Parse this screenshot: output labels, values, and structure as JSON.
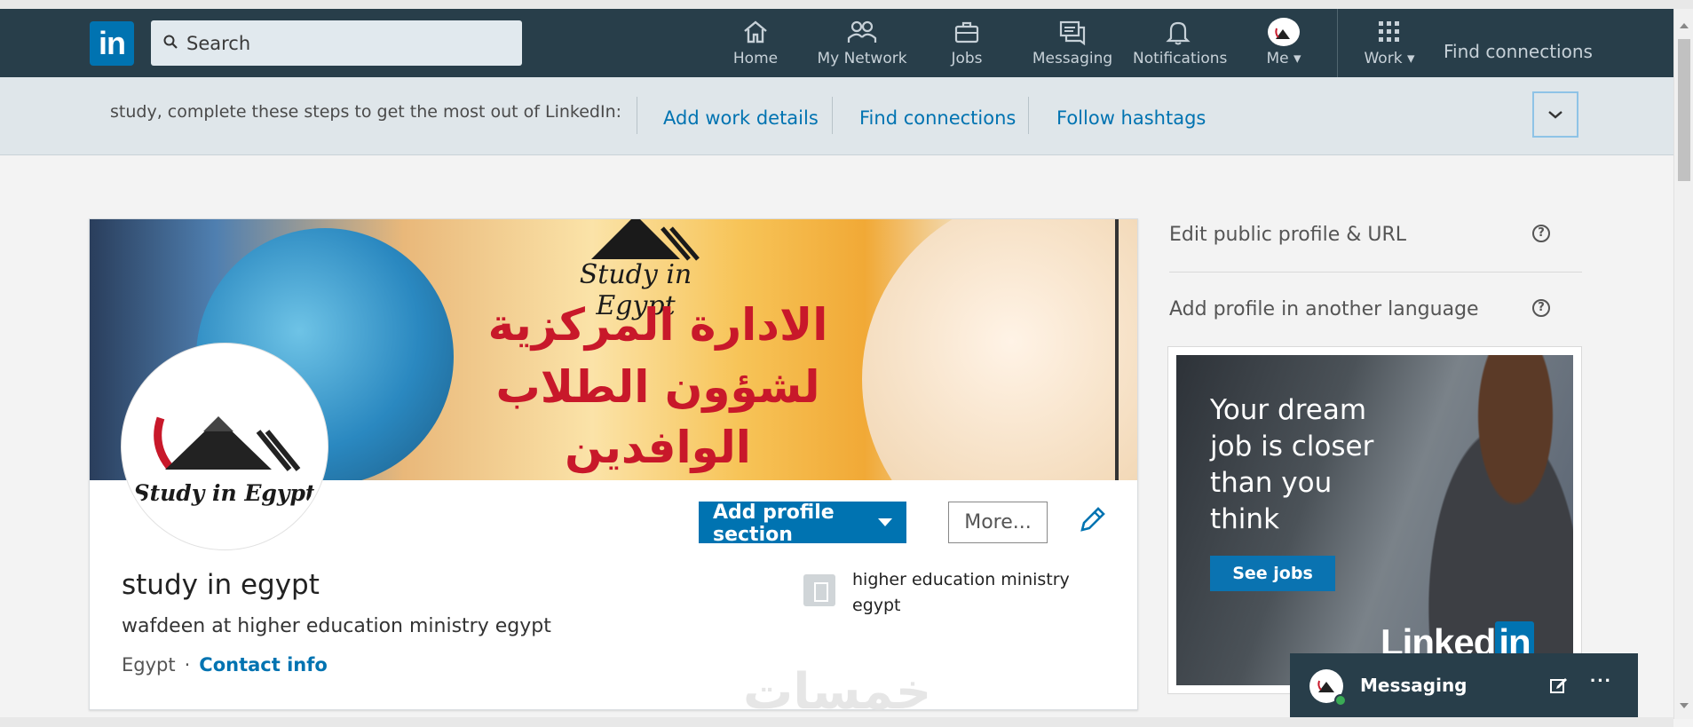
{
  "nav": {
    "search_placeholder": "Search",
    "items": [
      {
        "label": "Home",
        "icon": "home-icon"
      },
      {
        "label": "My Network",
        "icon": "network-icon"
      },
      {
        "label": "Jobs",
        "icon": "briefcase-icon"
      },
      {
        "label": "Messaging",
        "icon": "messaging-icon"
      },
      {
        "label": "Notifications",
        "icon": "bell-icon"
      },
      {
        "label": "Me",
        "icon": "avatar"
      },
      {
        "label": "Work",
        "icon": "grid-icon"
      }
    ],
    "find_connections": "Find connections",
    "logo_text": "in"
  },
  "onboarding": {
    "intro": "study, complete these steps to get the most out of LinkedIn:",
    "steps": [
      "Add work details",
      "Find connections",
      "Follow hashtags"
    ]
  },
  "profile": {
    "cover_brand": "Study in Egypt",
    "cover_arabic": [
      "الادارة المركزية",
      "لشؤون الطلاب",
      "الوافدين"
    ],
    "photo_brand": "Study in Egypt",
    "name": "study in egypt",
    "headline": "wafdeen at higher education ministry egypt",
    "location": "Egypt",
    "contact_info": "Contact info",
    "company": "higher education ministry egypt",
    "add_section_label": "Add profile section",
    "more_label": "More..."
  },
  "rail": {
    "edit_public": "Edit public profile & URL",
    "add_language": "Add profile in another language",
    "ad": {
      "headline": "Your dream job is closer than you think",
      "cta": "See jobs",
      "brand_a": "Linked",
      "brand_b": "in"
    }
  },
  "messaging": {
    "title": "Messaging"
  },
  "watermark": "خمسات",
  "colors": {
    "nav_bg": "#283e4a",
    "accent": "#0073b1",
    "onboard_bg": "#dfe6ea"
  }
}
